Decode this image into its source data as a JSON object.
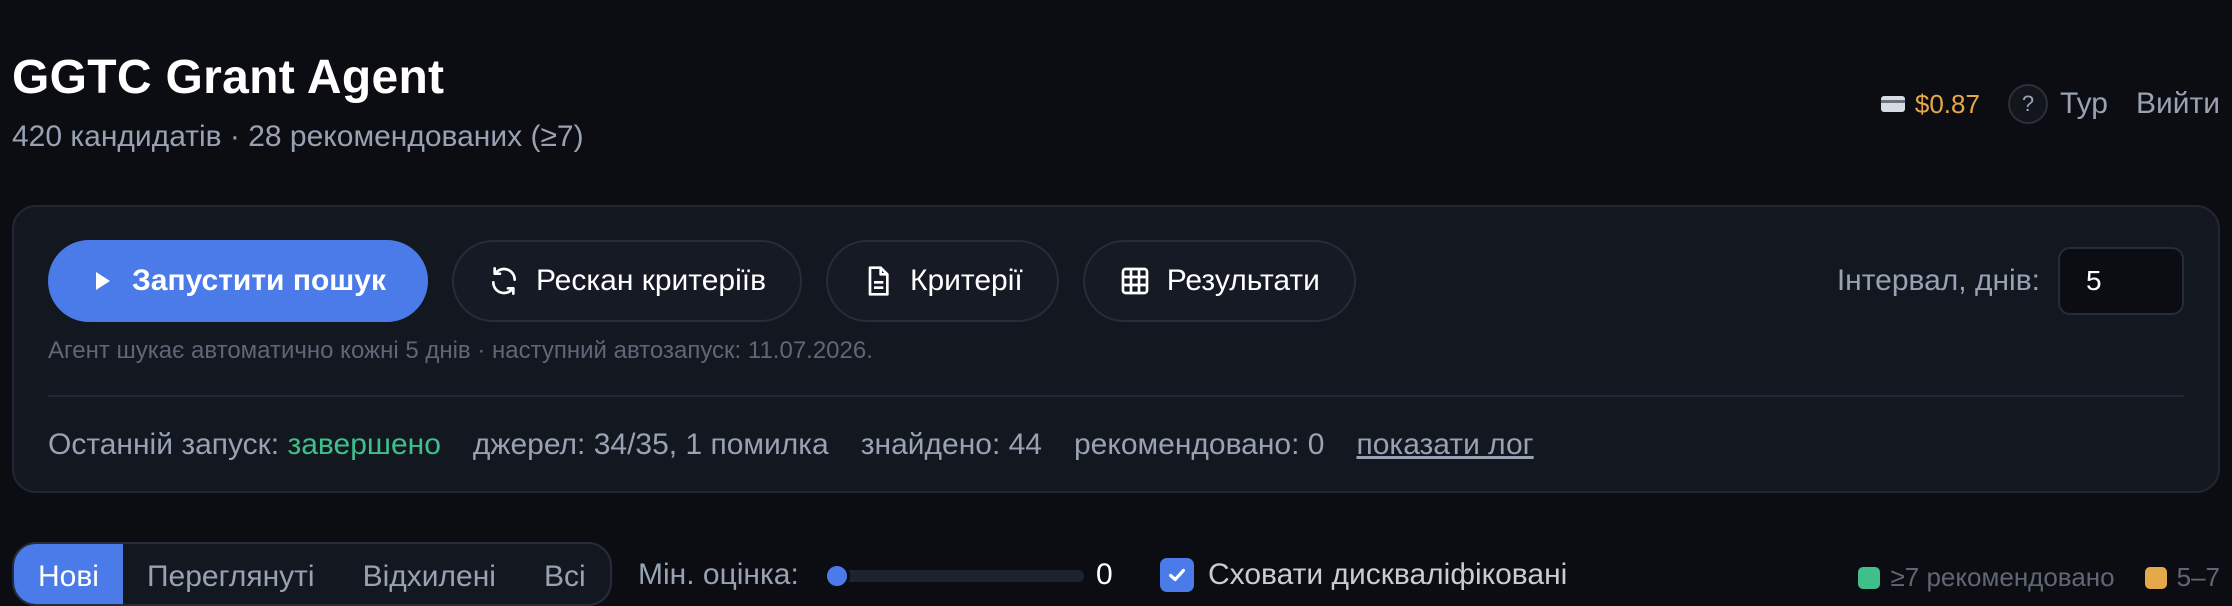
{
  "header": {
    "title": "GGTC Grant Agent",
    "subtitle": "420 кандидатів · 28 рекомендованих (≥7)",
    "balance": "$0.87",
    "tour_label": "Тур",
    "help_glyph": "?",
    "logout_label": "Вийти"
  },
  "actions": {
    "run_search_label": "Запустити пошук",
    "rescan_label": "Рескан критеріїв",
    "criteria_label": "Критерії",
    "results_label": "Результати",
    "interval_label": "Інтервал, днів:",
    "interval_value": "5"
  },
  "schedule_note": "Агент шукає автоматично кожні 5 днів · наступний автозапуск: 11.07.2026.",
  "last_run": {
    "label": "Останній запуск:",
    "status": "завершено",
    "sources": "джерел: 34/35, 1 помилка",
    "found": "знайдено: 44",
    "recommended": "рекомендовано: 0",
    "show_log": "показати лог"
  },
  "filters": {
    "tabs": [
      "Нові",
      "Переглянуті",
      "Відхилені",
      "Всі"
    ],
    "active_tab": "Нові",
    "min_score_label": "Мін. оцінка:",
    "min_score_value": "0",
    "min_score_fraction": 0,
    "hide_disqualified_label": "Сховати дискваліфіковані",
    "hide_disqualified_checked": true
  },
  "legend": [
    {
      "label": "≥7 рекомендовано",
      "color": "#3fbf8a"
    },
    {
      "label": "5–7",
      "color": "#e5a84a"
    }
  ],
  "colors": {
    "accent": "#4a7be8",
    "success": "#3fbf8a",
    "warning": "#e5a84a",
    "background": "#0b0d12"
  }
}
